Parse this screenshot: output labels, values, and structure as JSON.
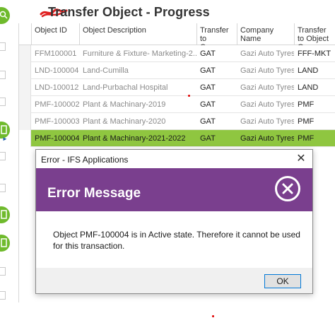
{
  "window": {
    "title": "Transfer Object - Progress"
  },
  "grid": {
    "columns": [
      "Object ID",
      "Object Description",
      "Transfer to Company",
      "Company Name",
      "Transfer to Object Grou"
    ],
    "rows": [
      [
        "FFM100001",
        "Furniture & Fixture- Marketing-2...",
        "GAT",
        "Gazi Auto Tyres",
        "FFF-MKT"
      ],
      [
        "LND-100004",
        "Land-Cumilla",
        "GAT",
        "Gazi Auto Tyres",
        "LAND"
      ],
      [
        "LND-100012",
        "Land-Purbachal Hospital",
        "GAT",
        "Gazi Auto Tyres",
        "LAND"
      ],
      [
        "PMF-100002",
        "Plant & Machinary-2019",
        "GAT",
        "Gazi Auto Tyres",
        "PMF"
      ],
      [
        "PMF-100003",
        "Plant & Machinary-2020",
        "GAT",
        "Gazi Auto Tyres",
        "PMF"
      ],
      [
        "PMF-100004",
        "Plant & Machinary-2021-2022",
        "GAT",
        "Gazi Auto Tyres",
        "PMF"
      ]
    ],
    "selected_row": 5
  },
  "dialog": {
    "title": "Error - IFS Applications",
    "close_glyph": "✕",
    "heading": "Error Message",
    "message": "Object PMF-100004 is in Active state. Therefore it cannot be used for this transaction.",
    "ok_label": "OK"
  },
  "icons": {
    "rail_top": "search-icon",
    "row_marker": "row-pointer-icon",
    "dialog_error": "error-x-icon"
  },
  "colors": {
    "accent_green": "#6fba2c",
    "selected_row": "#8fc640",
    "dialog_banner": "#7a3f8e",
    "button_border": "#0078d7"
  }
}
